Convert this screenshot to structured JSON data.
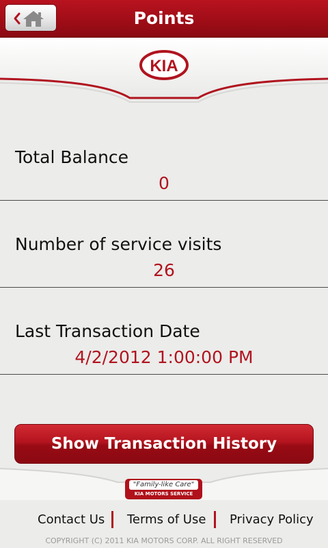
{
  "header": {
    "title": "Points",
    "home_icon": "home-icon",
    "back_icon": "chevron-left-icon"
  },
  "brand": {
    "logo_text": "KIA",
    "color": "#b0141f"
  },
  "points": {
    "rows": [
      {
        "label": "Total Balance",
        "value": "0"
      },
      {
        "label": "Number of service visits",
        "value": "26"
      },
      {
        "label": "Last Transaction Date",
        "value": "4/2/2012 1:00:00 PM"
      }
    ]
  },
  "actions": {
    "history_button_label": "Show Transaction History"
  },
  "badge": {
    "tagline": "\"Family-like Care\"",
    "service_text": "KIA MOTORS SERVICE"
  },
  "footer": {
    "links": [
      "Contact Us",
      "Terms of Use",
      "Privacy Policy"
    ],
    "copyright": "COPYRIGHT (C) 2011 KIA MOTORS CORP. ALL RIGHT RESERVED"
  }
}
